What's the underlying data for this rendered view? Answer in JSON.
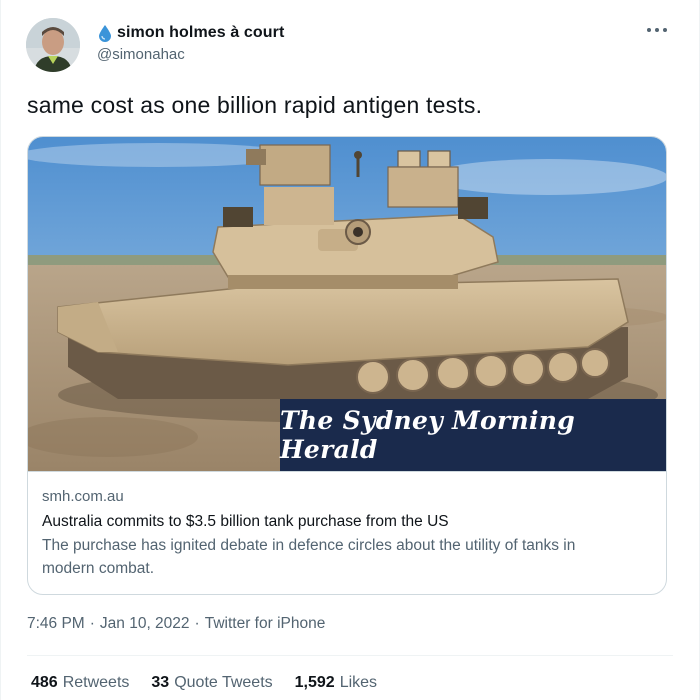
{
  "author": {
    "name": "simon holmes à court",
    "handle": "@simonahac",
    "name_emoji_icon": "water-drop-icon",
    "avatar_icon": "avatar"
  },
  "tweet": {
    "text": "same cost as one billion rapid antigen tests."
  },
  "card": {
    "image_banner_text": "The Sydney Morning Herald",
    "domain": "smh.com.au",
    "title": "Australia commits to $3.5 billion tank purchase from the US",
    "description_line1": "The purchase has ignited debate in defence circles about the utility of tanks in",
    "description_line2": "modern combat."
  },
  "meta": {
    "time": "7:46 PM",
    "date": "Jan 10, 2022",
    "source": "Twitter for iPhone",
    "separator": "·"
  },
  "stats": {
    "retweets_count": "486",
    "retweets_label": "Retweets",
    "quotes_count": "33",
    "quotes_label": "Quote Tweets",
    "likes_count": "1,592",
    "likes_label": "Likes"
  },
  "colors": {
    "accent_drop": "#3b94d9",
    "muted_text": "#536471",
    "primary_text": "#0f1419",
    "banner_bg": "#1a2a4c"
  }
}
